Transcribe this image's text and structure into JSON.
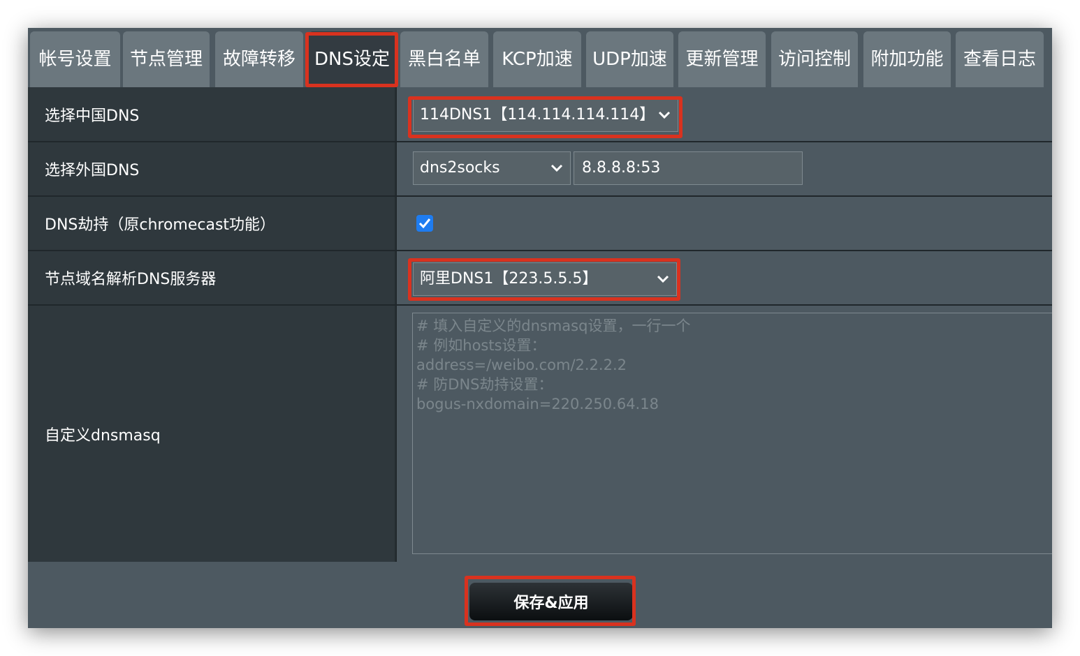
{
  "tabs": [
    {
      "label": "帐号设置"
    },
    {
      "label": "节点管理"
    },
    {
      "label": "故障转移"
    },
    {
      "label": "DNS设定",
      "active": true
    },
    {
      "label": "黑白名单"
    },
    {
      "label": "KCP加速"
    },
    {
      "label": "UDP加速"
    },
    {
      "label": "更新管理"
    },
    {
      "label": "访问控制"
    },
    {
      "label": "附加功能"
    },
    {
      "label": "查看日志"
    }
  ],
  "rows": {
    "china_dns": {
      "label": "选择中国DNS",
      "value": "114DNS1【114.114.114.114】"
    },
    "foreign_dns": {
      "label": "选择外国DNS",
      "value": "dns2socks",
      "server": "8.8.8.8:53"
    },
    "dns_hijack": {
      "label": "DNS劫持（原chromecast功能）",
      "checked": true
    },
    "node_dns": {
      "label": "节点域名解析DNS服务器",
      "value": "阿里DNS1【223.5.5.5】"
    },
    "custom_dnsmasq": {
      "label": "自定义dnsmasq",
      "placeholder": "# 填入自定义的dnsmasq设置，一行一个\n# 例如hosts设置：\naddress=/weibo.com/2.2.2.2\n# 防DNS劫持设置：\nbogus-nxdomain=220.250.64.18"
    }
  },
  "footer": {
    "save_label": "保存&应用"
  },
  "colors": {
    "highlight": "#d9321f",
    "checkbox": "#1e7cf0",
    "panel": "#4d5961",
    "label_bg": "#2f383d"
  }
}
